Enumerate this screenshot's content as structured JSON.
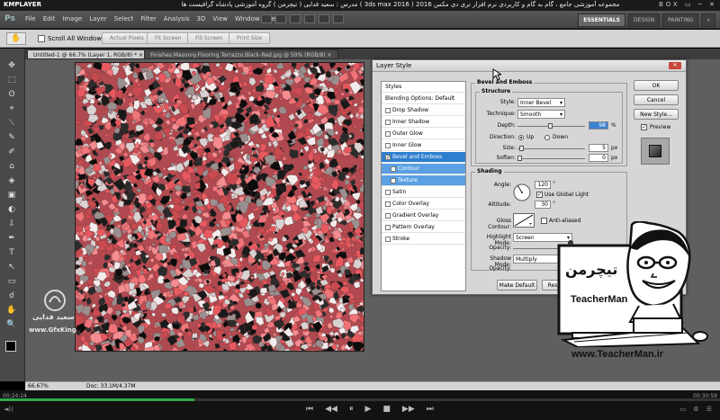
{
  "player": {
    "logo": "KMPLAYER",
    "caption": "مجموعه آموزشی جامع ، گام به گام و کاربردی نرم افزار تری دی مکس 2016 ( 3ds max 2016 )  مدرس : سعید فدایی ( تیچرمن ) گروه آموزشی پادشاه گرافیست ها",
    "window_buttons": "BOX ▭ ─ ✕",
    "time_elapsed": "00:24:24",
    "time_total": "00:30:59",
    "progress": 0.27,
    "controls": [
      "⏮",
      "◀◀",
      "⏸",
      "▶",
      "■",
      "▶▶",
      "⏭"
    ],
    "volume": "◄))",
    "right_tools": "▭ ⚙ ☰"
  },
  "ps": {
    "logo": "Ps",
    "menus": [
      "File",
      "Edit",
      "Image",
      "Layer",
      "Select",
      "Filter",
      "Analysis",
      "3D",
      "View",
      "Window",
      "Help"
    ],
    "workspaces": [
      "ESSENTIALS",
      "DESIGN",
      "PAINTING",
      "»"
    ],
    "options": {
      "tool_icon": "hand-icon",
      "scroll_all": "Scroll All Windows",
      "buttons": [
        "Actual Pixels",
        "Fit Screen",
        "Fill Screen",
        "Print Size"
      ]
    },
    "tools": [
      "✥",
      "⬚",
      "ʘ",
      "⌖",
      "⟍",
      "✎",
      "✐",
      "⌂",
      "◈",
      "▣",
      "◐",
      "⇩",
      "✒",
      "T",
      "↖",
      "▭",
      "☌",
      "✋",
      "🔍"
    ],
    "tabs": [
      "Untitled-1 @ 66.7% (Layer 1, RGB/8) *  ×",
      "Finishes.Masonry.Flooring.Terrazzo.Black-Red.jpg @ 50% (RGB/8)  ×"
    ],
    "status": {
      "zoom": "66.67%",
      "doc": "Doc: 33.1M/4.37M"
    },
    "watermark": {
      "name": "سعید فدایی",
      "site": "www.GfxKing"
    }
  },
  "dialog": {
    "title": "Layer Style",
    "styles_header": "Styles",
    "blending": "Blending Options: Default",
    "items": [
      {
        "label": "Drop Shadow",
        "checked": false
      },
      {
        "label": "Inner Shadow",
        "checked": false
      },
      {
        "label": "Outer Glow",
        "checked": false
      },
      {
        "label": "Inner Glow",
        "checked": false
      },
      {
        "label": "Bevel and Emboss",
        "checked": true
      },
      {
        "label": "Contour",
        "checked": false
      },
      {
        "label": "Texture",
        "checked": false
      },
      {
        "label": "Satin",
        "checked": false
      },
      {
        "label": "Color Overlay",
        "checked": false
      },
      {
        "label": "Gradient Overlay",
        "checked": false
      },
      {
        "label": "Pattern Overlay",
        "checked": false
      },
      {
        "label": "Stroke",
        "checked": false
      }
    ],
    "bevel_title": "Bevel and Emboss",
    "structure_title": "Structure",
    "style_label": "Style:",
    "style_value": "Inner Bevel",
    "technique_label": "Technique:",
    "technique_value": "Smooth",
    "depth_label": "Depth:",
    "depth_value": "98",
    "percent": "%",
    "direction_label": "Direction:",
    "dir_up": "Up",
    "dir_down": "Down",
    "size_label": "Size:",
    "size_value": "5",
    "soften_label": "Soften:",
    "soften_value": "0",
    "px": "px",
    "shading_title": "Shading",
    "angle_label": "Angle:",
    "angle_value": "120",
    "degree": "°",
    "use_global": "Use Global Light",
    "altitude_label": "Altitude:",
    "altitude_value": "30",
    "gloss_label": "Gloss Contour:",
    "anti_aliased": "Anti-aliased",
    "highlight_label": "Highlight Mode:",
    "highlight_value": "Screen",
    "opacity_label": "Opacity:",
    "shadow_label": "Shadow Mode:",
    "shadow_value": "Multiply",
    "make_default": "Make Default",
    "reset_default": "Reset",
    "ok": "OK",
    "cancel": "Cancel",
    "new_style": "New Style...",
    "preview": "Preview"
  },
  "overlay": {
    "brand": "تیچرمن",
    "brand_sub": "TeacherMan",
    "url": "www.TeacherMan.ir"
  }
}
